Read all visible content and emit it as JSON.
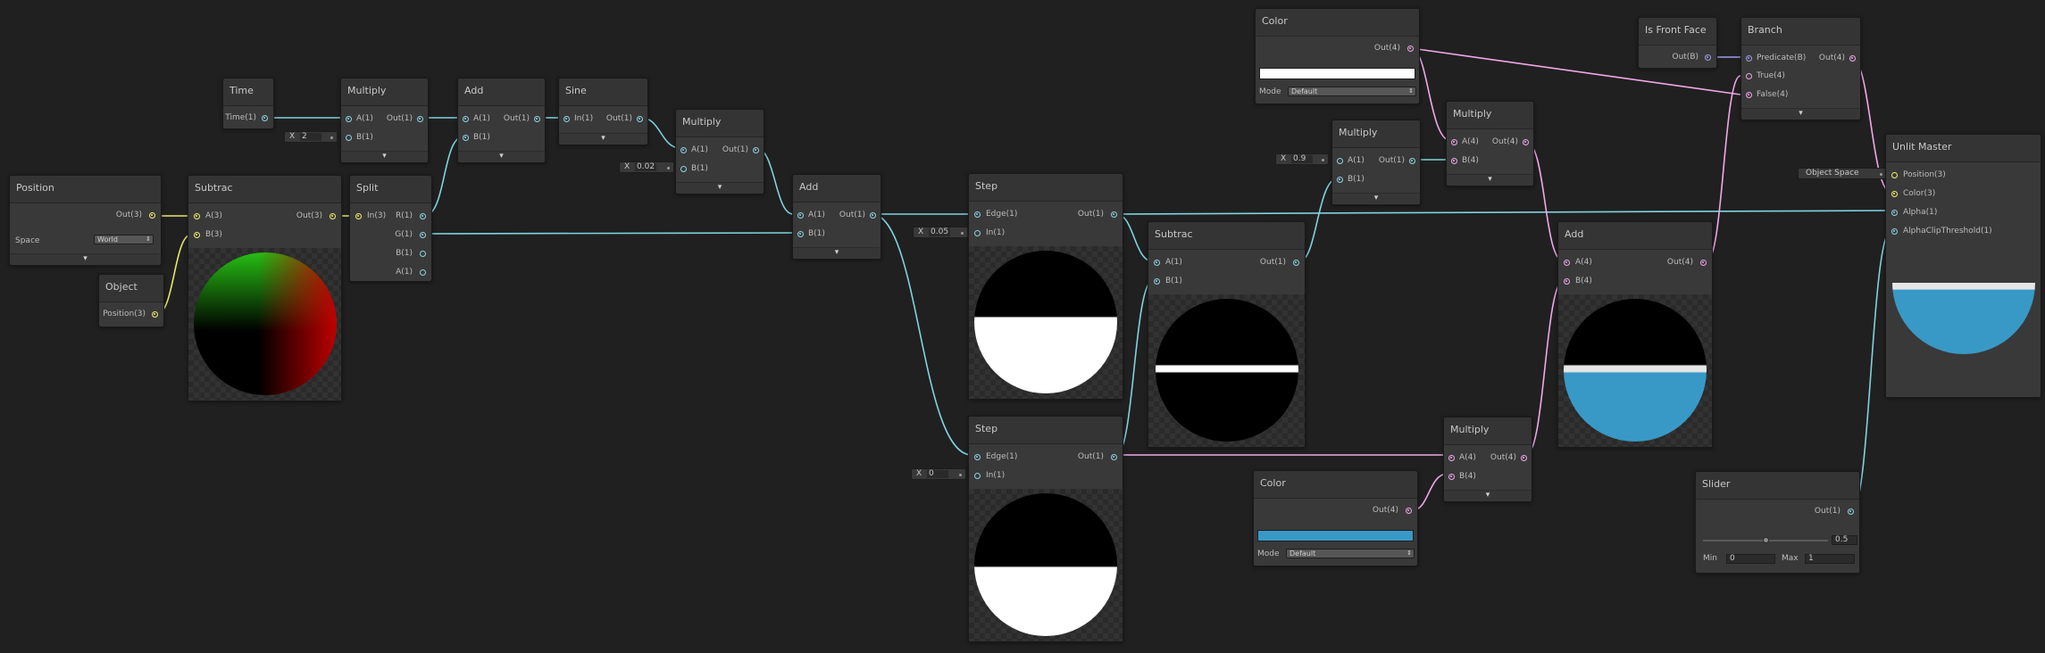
{
  "nodes": {
    "position": {
      "title": "Position",
      "out": "Out(3)",
      "space_label": "Space",
      "space_value": "World"
    },
    "object": {
      "title": "Object",
      "out": "Position(3)"
    },
    "subtract1": {
      "title": "Subtrac",
      "a": "A(3)",
      "b": "B(3)",
      "out": "Out(3)"
    },
    "split": {
      "title": "Split",
      "in": "In(3)",
      "r": "R(1)",
      "g": "G(1)",
      "b": "B(1)",
      "a": "A(1)"
    },
    "time": {
      "title": "Time",
      "out": "Time(1)"
    },
    "multiply1": {
      "title": "Multiply",
      "a": "A(1)",
      "b": "B(1)",
      "out": "Out(1)",
      "b_value": "2"
    },
    "add1": {
      "title": "Add",
      "a": "A(1)",
      "b": "B(1)",
      "out": "Out(1)"
    },
    "sine": {
      "title": "Sine",
      "in": "In(1)",
      "out": "Out(1)"
    },
    "multiply2": {
      "title": "Multiply",
      "a": "A(1)",
      "b": "B(1)",
      "out": "Out(1)",
      "b_value": "0.02"
    },
    "add2": {
      "title": "Add",
      "a": "A(1)",
      "b": "B(1)",
      "out": "Out(1)"
    },
    "step1": {
      "title": "Step",
      "edge": "Edge(1)",
      "in": "In(1)",
      "out": "Out(1)",
      "in_value": "0.05"
    },
    "step2": {
      "title": "Step",
      "edge": "Edge(1)",
      "in": "In(1)",
      "out": "Out(1)",
      "in_value": "0"
    },
    "subtract2": {
      "title": "Subtrac",
      "a": "A(1)",
      "b": "B(1)",
      "out": "Out(1)"
    },
    "multiply3": {
      "title": "Multiply",
      "a": "A(1)",
      "b": "B(1)",
      "out": "Out(1)",
      "a_value": "0.9"
    },
    "color1": {
      "title": "Color",
      "out": "Out(4)",
      "mode_label": "Mode",
      "mode_value": "Default",
      "swatch": "#ffffff"
    },
    "multiply4": {
      "title": "Multiply",
      "a": "A(4)",
      "b": "B(4)",
      "out": "Out(4)"
    },
    "multiply5": {
      "title": "Multiply",
      "a": "A(4)",
      "b": "B(4)",
      "out": "Out(4)"
    },
    "color2": {
      "title": "Color",
      "out": "Out(4)",
      "mode_label": "Mode",
      "mode_value": "Default",
      "swatch": "#3899c6"
    },
    "add3": {
      "title": "Add",
      "a": "A(4)",
      "b": "B(4)",
      "out": "Out(4)"
    },
    "is_front_face": {
      "title": "Is Front Face",
      "out": "Out(B)"
    },
    "branch": {
      "title": "Branch",
      "predicate": "Predicate(B)",
      "true": "True(4)",
      "false": "False(4)",
      "out": "Out(4)"
    },
    "slider": {
      "title": "Slider",
      "out": "Out(1)",
      "value": "0.5",
      "min_label": "Min",
      "min_value": "0",
      "max_label": "Max",
      "max_value": "1",
      "level": 0.5
    },
    "unlit_master": {
      "title": "Unlit Master",
      "position": "Position(3)",
      "color": "Color(3)",
      "alpha": "Alpha(1)",
      "clip": "AlphaClipThreshold(1)",
      "space_value": "Object Space"
    }
  },
  "input_prefix": "X",
  "colors": {
    "background": "#202020",
    "wire_float": "#7fd3df",
    "wire_vector3": "#e8e86a",
    "wire_vector4": "#f1a7e8",
    "wire_bool": "#9d9df0",
    "accent_blue": "#3899c6"
  }
}
